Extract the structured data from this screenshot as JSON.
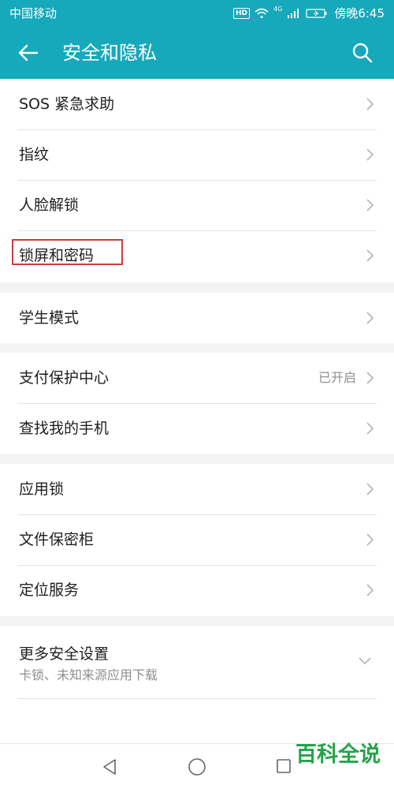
{
  "status_bar": {
    "carrier": "中国移动",
    "network": "HD",
    "signal": "4G",
    "time": "傍晚6:45"
  },
  "header": {
    "title": "安全和隐私",
    "back_icon": "arrow-left-icon",
    "search_icon": "search-icon"
  },
  "sections": [
    {
      "items": [
        {
          "label": "SOS 紧急求助"
        },
        {
          "label": "指纹"
        },
        {
          "label": "人脸解锁"
        },
        {
          "label": "锁屏和密码"
        }
      ]
    },
    {
      "items": [
        {
          "label": "学生模式"
        }
      ]
    },
    {
      "items": [
        {
          "label": "支付保护中心",
          "status": "已开启"
        },
        {
          "label": "查找我的手机"
        }
      ]
    },
    {
      "items": [
        {
          "label": "应用锁"
        },
        {
          "label": "文件保密柜"
        },
        {
          "label": "定位服务"
        }
      ]
    }
  ],
  "more_settings": {
    "label": "更多安全设置",
    "subtitle": "卡锁、未知来源应用下载"
  },
  "navbar": {
    "back_icon": "triangle-back-icon",
    "home_icon": "circle-home-icon",
    "recent_icon": "square-recent-icon"
  },
  "watermark": {
    "title": "百科全说",
    "subtitle": "助你轻松解决"
  },
  "colors": {
    "accent": "#15a9bb",
    "background": "#f4f4f4",
    "highlight": "#cf3b3b",
    "watermark": "#25a34b"
  }
}
